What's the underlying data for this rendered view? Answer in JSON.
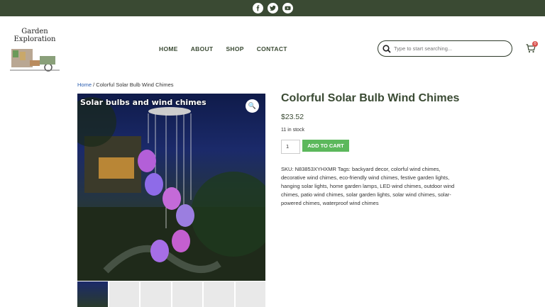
{
  "social": [
    "facebook-icon",
    "twitter-icon",
    "youtube-icon"
  ],
  "logo": {
    "text_line1": "Garden",
    "text_line2": "Exploration"
  },
  "nav": {
    "items": [
      "HOME",
      "ABOUT",
      "SHOP",
      "CONTACT"
    ]
  },
  "search": {
    "placeholder": "Type to start searching..."
  },
  "cart": {
    "count": "0"
  },
  "breadcrumb": {
    "home": "Home",
    "separator": " / ",
    "current": "Colorful Solar Bulb Wind Chimes"
  },
  "product": {
    "image_caption": "Solar bulbs and wind chimes",
    "title": "Colorful Solar Bulb Wind Chimes",
    "price": "$23.52",
    "stock": "11 in stock",
    "quantity": "1",
    "add_to_cart": "ADD TO CART",
    "sku_label": "SKU:",
    "sku": "N83853XYHXMR",
    "tags_label": "Tags:",
    "tags": [
      "backyard decor",
      "colorful wind chimes",
      "decorative wind chimes",
      "eco-friendly wind chimes",
      "festive garden lights",
      "hanging solar lights",
      "home garden lamps",
      "LED wind chimes",
      "outdoor wind chimes",
      "patio wind chimes",
      "solar garden lights",
      "solar wind chimes",
      "solar-powered chimes",
      "waterproof wind chimes"
    ]
  },
  "colors": {
    "brand": "#3a4a33",
    "button": "#5cb85c",
    "badge": "#d9534f"
  }
}
